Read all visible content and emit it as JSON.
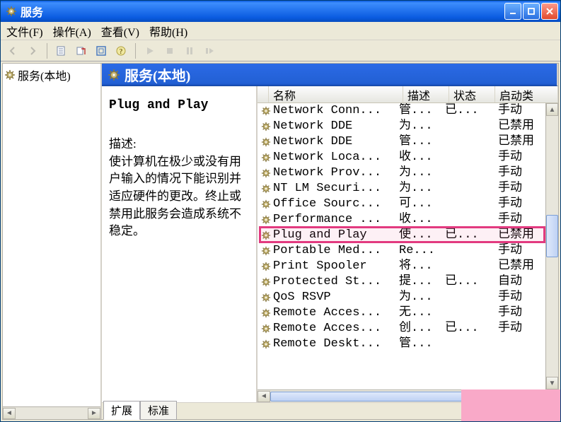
{
  "window": {
    "title": "服务"
  },
  "menu": {
    "file": "文件(F)",
    "action": "操作(A)",
    "view": "查看(V)",
    "help": "帮助(H)"
  },
  "tree": {
    "root": "服务(本地)"
  },
  "banner": "服务(本地)",
  "detail": {
    "title": "Plug and Play",
    "desc_label": "描述:",
    "desc": "使计算机在极少或没有用户输入的情况下能识别并适应硬件的更改。终止或禁用此服务会造成系统不稳定。"
  },
  "columns": {
    "name": "名称",
    "desc": "描述",
    "status": "状态",
    "startup": "启动类"
  },
  "tabs": {
    "extended": "扩展",
    "standard": "标准"
  },
  "highlight_index": 8,
  "services": [
    {
      "name": "Network Conn...",
      "desc": "管...",
      "status": "已...",
      "startup": "手动"
    },
    {
      "name": "Network DDE",
      "desc": "为...",
      "status": "",
      "startup": "已禁用"
    },
    {
      "name": "Network DDE ",
      "desc": "管...",
      "status": "",
      "startup": "已禁用"
    },
    {
      "name": "Network Loca...",
      "desc": "收...",
      "status": "",
      "startup": "手动"
    },
    {
      "name": "Network Prov...",
      "desc": "为...",
      "status": "",
      "startup": "手动"
    },
    {
      "name": "NT LM Securi...",
      "desc": "为...",
      "status": "",
      "startup": "手动"
    },
    {
      "name": "Office Sourc...",
      "desc": "可...",
      "status": "",
      "startup": "手动"
    },
    {
      "name": "Performance ...",
      "desc": "收...",
      "status": "",
      "startup": "手动"
    },
    {
      "name": "Plug and Play",
      "desc": "使...",
      "status": "已...",
      "startup": "已禁用"
    },
    {
      "name": "Portable Med...",
      "desc": "Re...",
      "status": "",
      "startup": "手动"
    },
    {
      "name": "Print Spooler",
      "desc": "将...",
      "status": "",
      "startup": "已禁用"
    },
    {
      "name": "Protected St...",
      "desc": "提...",
      "status": "已...",
      "startup": "自动"
    },
    {
      "name": "QoS RSVP",
      "desc": "为...",
      "status": "",
      "startup": "手动"
    },
    {
      "name": "Remote Acces...",
      "desc": "无...",
      "status": "",
      "startup": "手动"
    },
    {
      "name": "Remote Acces...",
      "desc": "创...",
      "status": "已...",
      "startup": "手动"
    },
    {
      "name": "Remote Deskt...",
      "desc": "管...",
      "status": "",
      "startup": ""
    }
  ]
}
